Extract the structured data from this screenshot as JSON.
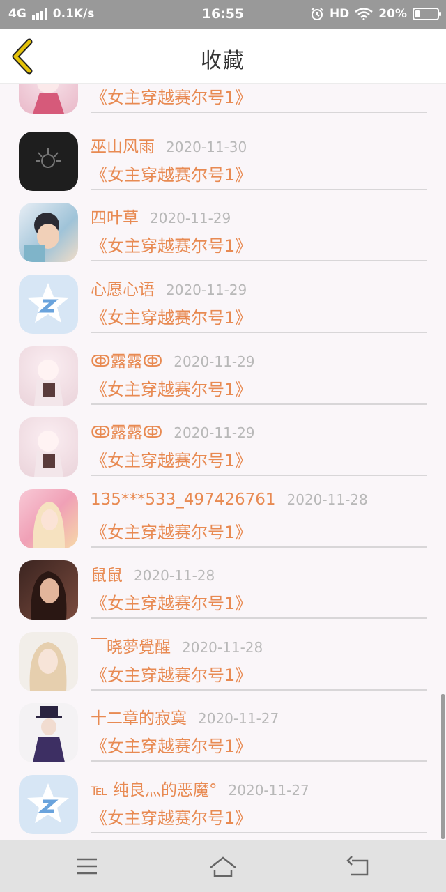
{
  "status_bar": {
    "network": "4G",
    "speed": "0.1K/s",
    "time": "16:55",
    "hd": "HD",
    "battery": "20%",
    "battery_level": 0.2
  },
  "header": {
    "title": "收藏"
  },
  "favorites": [
    {
      "name": "",
      "date": "",
      "book": "《女主穿越赛尔号1》",
      "avatar": "anime-avatar"
    },
    {
      "name": "巫山风雨",
      "date": "2020-11-30",
      "book": "《女主穿越赛尔号1》",
      "avatar": "dark-logo-avatar"
    },
    {
      "name": "四叶草",
      "date": "2020-11-29",
      "book": "《女主穿越赛尔号1》",
      "avatar": "photo-avatar"
    },
    {
      "name": "心愿心语",
      "date": "2020-11-29",
      "book": "《女主穿越赛尔号1》",
      "avatar": "qq-star-avatar"
    },
    {
      "name": "ↂ露露ↂ",
      "date": "2020-11-29",
      "book": "《女主穿越赛尔号1》",
      "avatar": "anime-avatar"
    },
    {
      "name": "ↂ露露ↂ",
      "date": "2020-11-29",
      "book": "《女主穿越赛尔号1》",
      "avatar": "anime-avatar"
    },
    {
      "name": "135***533_497426761",
      "date": "2020-11-28",
      "book": "《女主穿越赛尔号1》",
      "avatar": "anime-girl-avatar"
    },
    {
      "name": "鼠鼠",
      "date": "2020-11-28",
      "book": "《女主穿越赛尔号1》",
      "avatar": "portrait-avatar"
    },
    {
      "name": "￣晓夢覺醒",
      "date": "2020-11-28",
      "book": "《女主穿越赛尔号1》",
      "avatar": "blonde-avatar"
    },
    {
      "name": "十二章的寂寞",
      "date": "2020-11-27",
      "book": "《女主穿越赛尔号1》",
      "avatar": "dark-anime-avatar"
    },
    {
      "name": "℡ 纯良灬的恶魔°",
      "date": "2020-11-27",
      "book": "《女主穿越赛尔号1》",
      "avatar": "qq-star-avatar"
    }
  ],
  "icons": {
    "back": "chevron-left-icon",
    "menu": "menu-icon",
    "home": "home-icon",
    "return": "return-icon"
  },
  "colors": {
    "accent": "#e88a52",
    "date": "#b8b8b8",
    "back_chevron": "#e4c20a"
  }
}
